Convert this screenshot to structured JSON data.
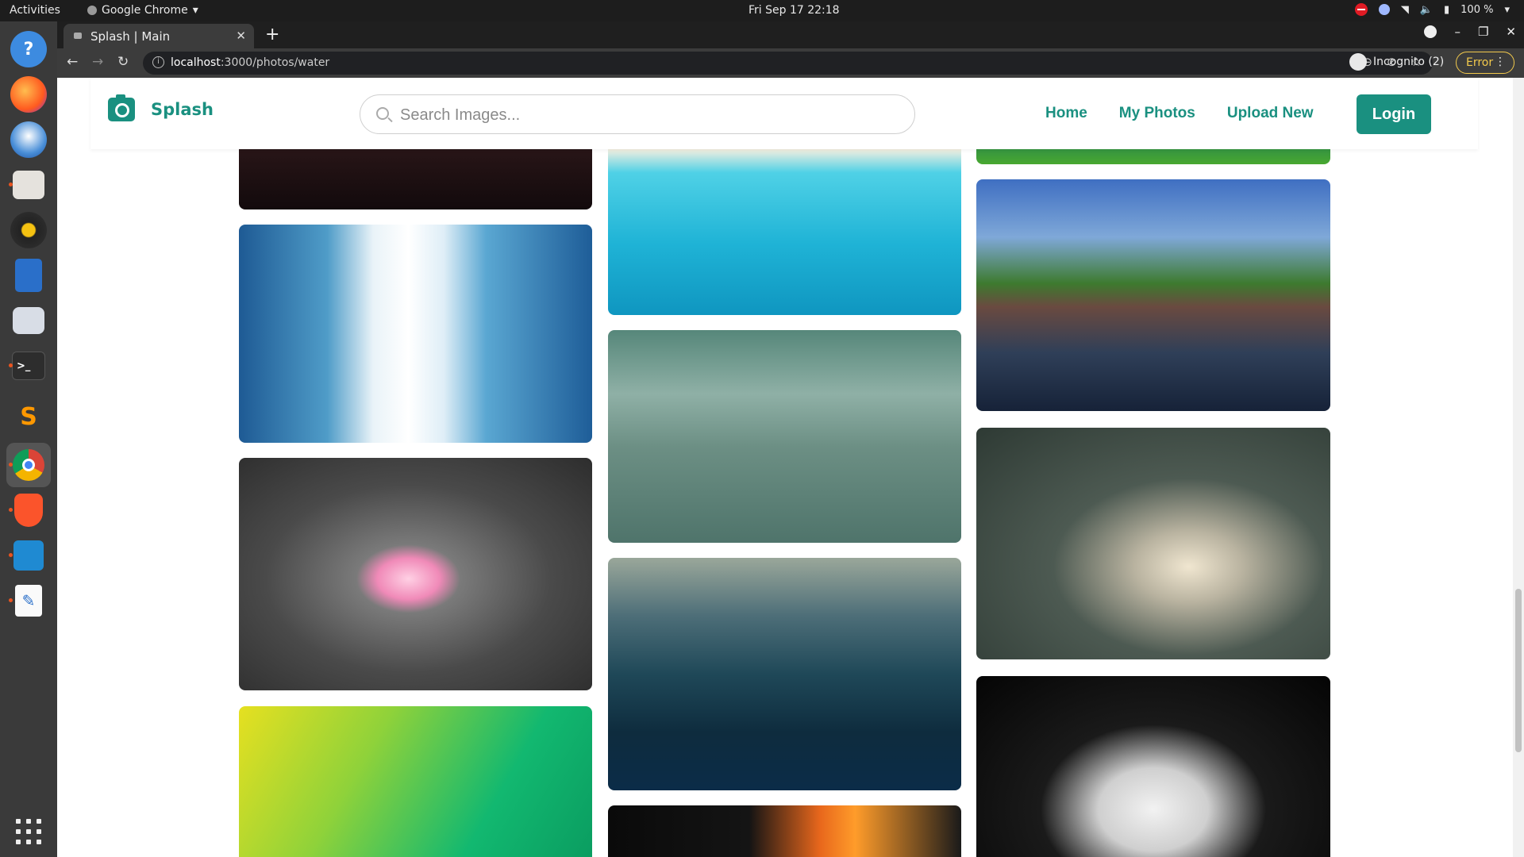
{
  "system": {
    "activities": "Activities",
    "app_name": "Google Chrome",
    "clock": "Fri Sep 17  22:18",
    "battery": "100 %"
  },
  "browser": {
    "tab_title": "Splash | Main",
    "url_host": "localhost",
    "url_path": ":3000/photos/water",
    "incognito_label": "Incognito (2)",
    "error_label": "Error"
  },
  "site": {
    "brand": "Splash",
    "search_placeholder": "Search Images...",
    "nav": [
      "Home",
      "My Photos",
      "Upload New"
    ],
    "login": "Login",
    "accent": "#1a9080"
  },
  "dock_apps": [
    {
      "name": "help",
      "label": "?"
    },
    {
      "name": "firefox",
      "label": ""
    },
    {
      "name": "thunderbird",
      "label": ""
    },
    {
      "name": "files",
      "label": ""
    },
    {
      "name": "rhythmbox",
      "label": ""
    },
    {
      "name": "libreoffice-writer",
      "label": ""
    },
    {
      "name": "software-center",
      "label": ""
    },
    {
      "name": "terminal",
      "label": ">_"
    },
    {
      "name": "sublime-text",
      "label": "S"
    },
    {
      "name": "chrome",
      "label": ""
    },
    {
      "name": "brave",
      "label": ""
    },
    {
      "name": "vscode",
      "label": ""
    },
    {
      "name": "text-editor",
      "label": ""
    }
  ]
}
